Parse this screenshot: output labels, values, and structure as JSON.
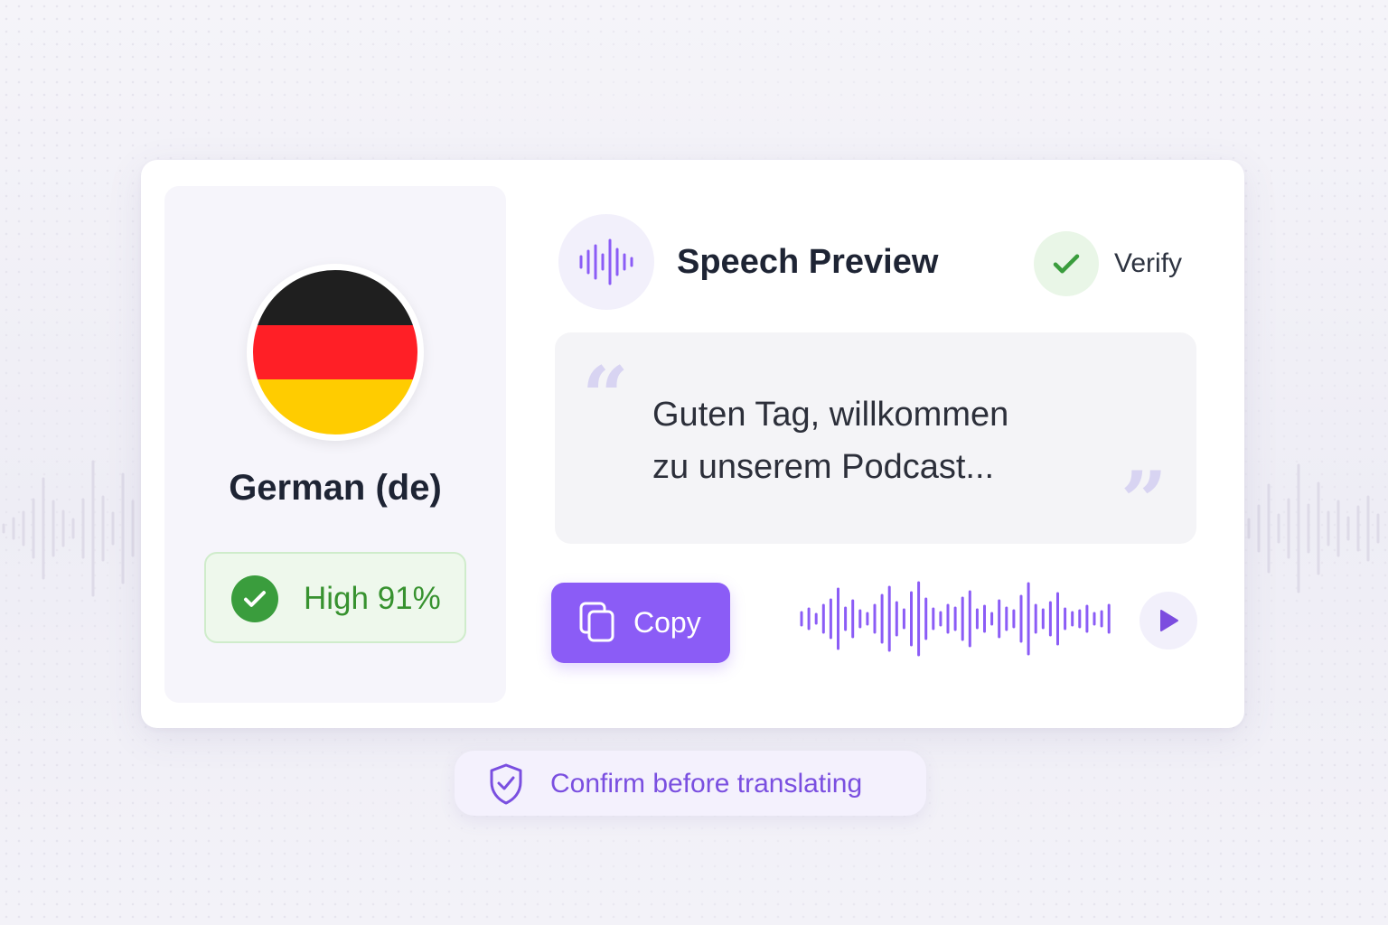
{
  "language": {
    "name": "German (de)",
    "flag_colors": [
      "#1f1f1f",
      "#ff1f26",
      "#ffcc00"
    ],
    "confidence": {
      "label": "High 91%",
      "level": "High",
      "percent": 91
    }
  },
  "preview": {
    "title": "Speech Preview",
    "verify_label": "Verify",
    "quote_line1": "Guten Tag, willkommen",
    "quote_line2": "zu unserem Podcast...",
    "copy_label": "Copy",
    "play_icon": "play-icon"
  },
  "footer": {
    "confirm_label": "Confirm before translating",
    "icon": "shield-check-icon"
  },
  "colors": {
    "accent": "#8b5cf6",
    "success": "#3a9d3d",
    "success_bg": "#eef8ec",
    "text_dark": "#1e2434"
  }
}
